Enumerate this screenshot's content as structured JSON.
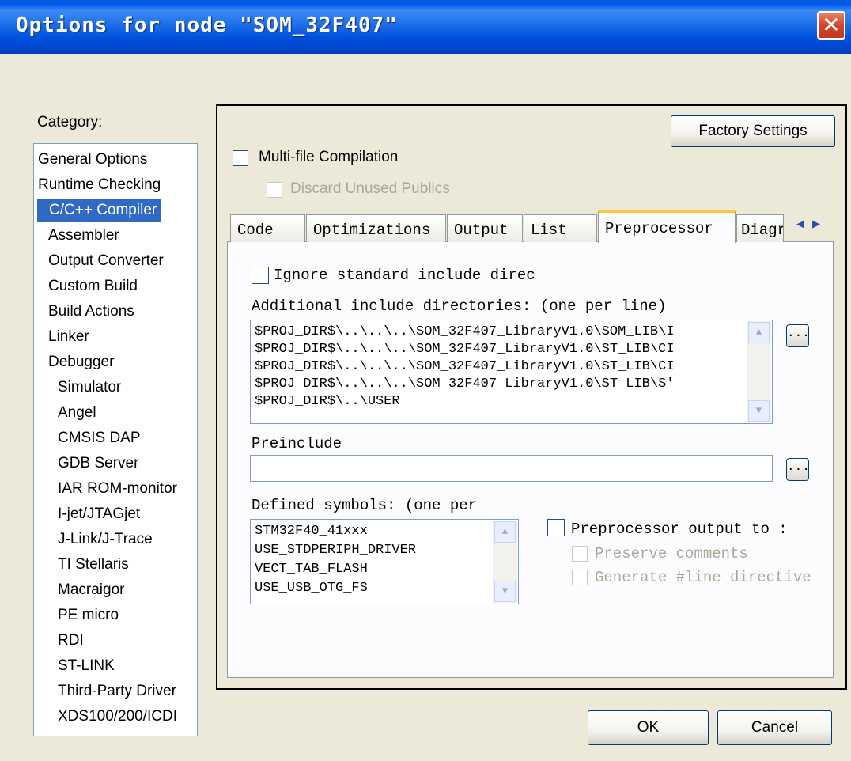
{
  "window": {
    "title": "Options for node \"SOM_32F407\""
  },
  "category": {
    "label": "Category:",
    "items": [
      "General Options",
      "Runtime Checking",
      "C/C++ Compiler",
      "Assembler",
      "Output Converter",
      "Custom Build",
      "Build Actions",
      "Linker",
      "Debugger",
      "Simulator",
      "Angel",
      "CMSIS DAP",
      "GDB Server",
      "IAR ROM-monitor",
      "I-jet/JTAGjet",
      "J-Link/J-Trace",
      "TI Stellaris",
      "Macraigor",
      "PE micro",
      "RDI",
      "ST-LINK",
      "Third-Party Driver",
      "XDS100/200/ICDI"
    ],
    "selected": "C/C++ Compiler"
  },
  "factory_settings": "Factory Settings",
  "multi_file": "Multi-file Compilation",
  "discard_unused": "Discard Unused Publics",
  "tabs": [
    "Code",
    "Optimizations",
    "Output",
    "List",
    "Preprocessor",
    "Diagr"
  ],
  "active_tab": "Preprocessor",
  "preprocessor": {
    "ignore_std": "Ignore standard include direc",
    "additional_label": "Additional include directories: (one per line)",
    "additional_lines": [
      "$PROJ_DIR$\\..\\..\\..\\SOM_32F407_LibraryV1.0\\SOM_LIB\\I",
      "$PROJ_DIR$\\..\\..\\..\\SOM_32F407_LibraryV1.0\\ST_LIB\\CI",
      "$PROJ_DIR$\\..\\..\\..\\SOM_32F407_LibraryV1.0\\ST_LIB\\CI",
      "$PROJ_DIR$\\..\\..\\..\\SOM_32F407_LibraryV1.0\\ST_LIB\\S'",
      "$PROJ_DIR$\\..\\USER"
    ],
    "preinclude_label": "Preinclude",
    "preinclude_value": "",
    "defined_label": "Defined symbols: (one per",
    "defined_lines": [
      "STM32F40_41xxx",
      "USE_STDPERIPH_DRIVER",
      "VECT_TAB_FLASH",
      "USE_USB_OTG_FS"
    ],
    "pp_output": "Preprocessor output to :",
    "preserve_comments": "Preserve comments",
    "generate_line": "Generate #line directive"
  },
  "browse": "...",
  "ok": "OK",
  "cancel": "Cancel"
}
